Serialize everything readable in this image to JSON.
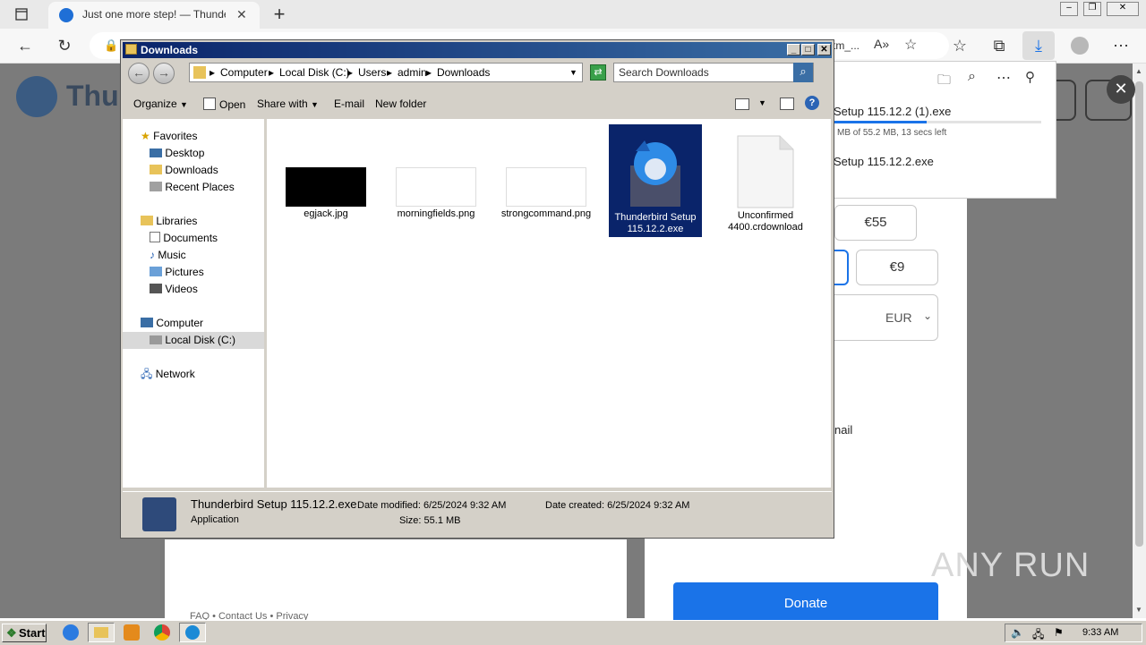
{
  "browser": {
    "tab_title": "Just one more step! — Thunderbird",
    "new_tab_icon": "plus-icon",
    "url_fragment": "tm_...",
    "window_controls": [
      "minimize",
      "restore",
      "close"
    ]
  },
  "downloads_panel": {
    "item1_name": "Setup 115.12.2 (1).exe",
    "item1_progress_text": "MB of 55.2 MB, 13 secs left",
    "item1_progress": 0.45,
    "item2_name": "Setup 115.12.2.exe"
  },
  "page_behind": {
    "logo_text": "Thu",
    "amounts": [
      "€55",
      "€9"
    ],
    "currency": "EUR",
    "email_fragment": "nail",
    "footer_links": [
      "FAQ",
      "Contact Us",
      "Privacy"
    ],
    "donate_label": "Donate",
    "watermark": "ANY RUN"
  },
  "explorer": {
    "title": "Downloads",
    "breadcrumb": [
      "Computer",
      "Local Disk (C:)",
      "Users",
      "admin",
      "Downloads"
    ],
    "search_placeholder": "Search Downloads",
    "toolbar": {
      "organize": "Organize",
      "open": "Open",
      "share_with": "Share with",
      "email": "E-mail",
      "new_folder": "New folder"
    },
    "nav": {
      "favorites": "Favorites",
      "desktop": "Desktop",
      "downloads": "Downloads",
      "recent": "Recent Places",
      "libraries": "Libraries",
      "documents": "Documents",
      "music": "Music",
      "pictures": "Pictures",
      "videos": "Videos",
      "computer": "Computer",
      "localdisk": "Local Disk (C:)",
      "network": "Network"
    },
    "files": [
      {
        "name": "egjack.jpg"
      },
      {
        "name": "morningfields.png"
      },
      {
        "name": "strongcommand.png"
      },
      {
        "name": "Thunderbird Setup 115.12.2.exe",
        "selected": true
      },
      {
        "name": "Unconfirmed 4400.crdownload"
      }
    ],
    "status": {
      "name": "Thunderbird Setup 115.12.2.exe",
      "type": "Application",
      "modified_label": "Date modified:",
      "modified": "6/25/2024 9:32 AM",
      "created_label": "Date created:",
      "created": "6/25/2024 9:32 AM",
      "size_label": "Size:",
      "size": "55.1 MB"
    }
  },
  "taskbar": {
    "start": "Start",
    "clock": "9:33 AM"
  }
}
